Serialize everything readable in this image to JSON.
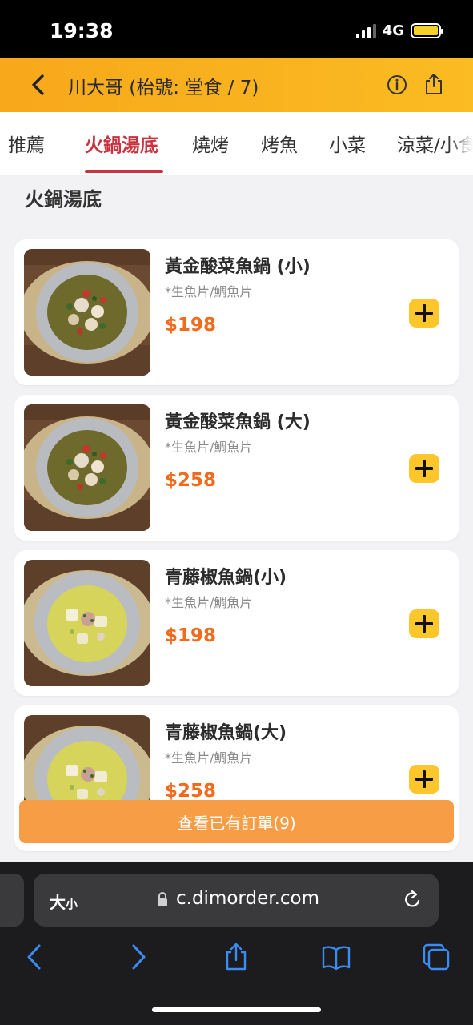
{
  "status_bar": {
    "time": "19:38",
    "network": "4G"
  },
  "header": {
    "title": "川大哥 (枱號: 堂食 / 7)"
  },
  "tabs": [
    {
      "label": "推薦"
    },
    {
      "label": "火鍋湯底"
    },
    {
      "label": "燒烤"
    },
    {
      "label": "烤魚"
    },
    {
      "label": "小菜"
    },
    {
      "label": "涼菜/小食"
    }
  ],
  "active_tab_index": 1,
  "section": {
    "title": "火鍋湯底"
  },
  "items": [
    {
      "name": "黃金酸菜魚鍋 (小)",
      "desc": "*生魚片/鯛魚片",
      "price": "$198",
      "soup": "red"
    },
    {
      "name": "黃金酸菜魚鍋 (大)",
      "desc": "*生魚片/鯛魚片",
      "price": "$258",
      "soup": "red"
    },
    {
      "name": "青藤椒魚鍋(小)",
      "desc": "*生魚片/鯛魚片",
      "price": "$198",
      "soup": "green"
    },
    {
      "name": "青藤椒魚鍋(大)",
      "desc": "*生魚片/鯛魚片",
      "price": "$258",
      "soup": "green"
    }
  ],
  "order_bar": {
    "label": "查看已有訂單(9)"
  },
  "browser": {
    "text_size_big": "大",
    "text_size_small": "小",
    "url": "c.dimorder.com"
  },
  "colors": {
    "accent": "#f7a81b",
    "active_tab": "#c8333f",
    "price": "#f26a1b",
    "add_button": "#fdc72b",
    "order_bar": "#f79d45"
  }
}
